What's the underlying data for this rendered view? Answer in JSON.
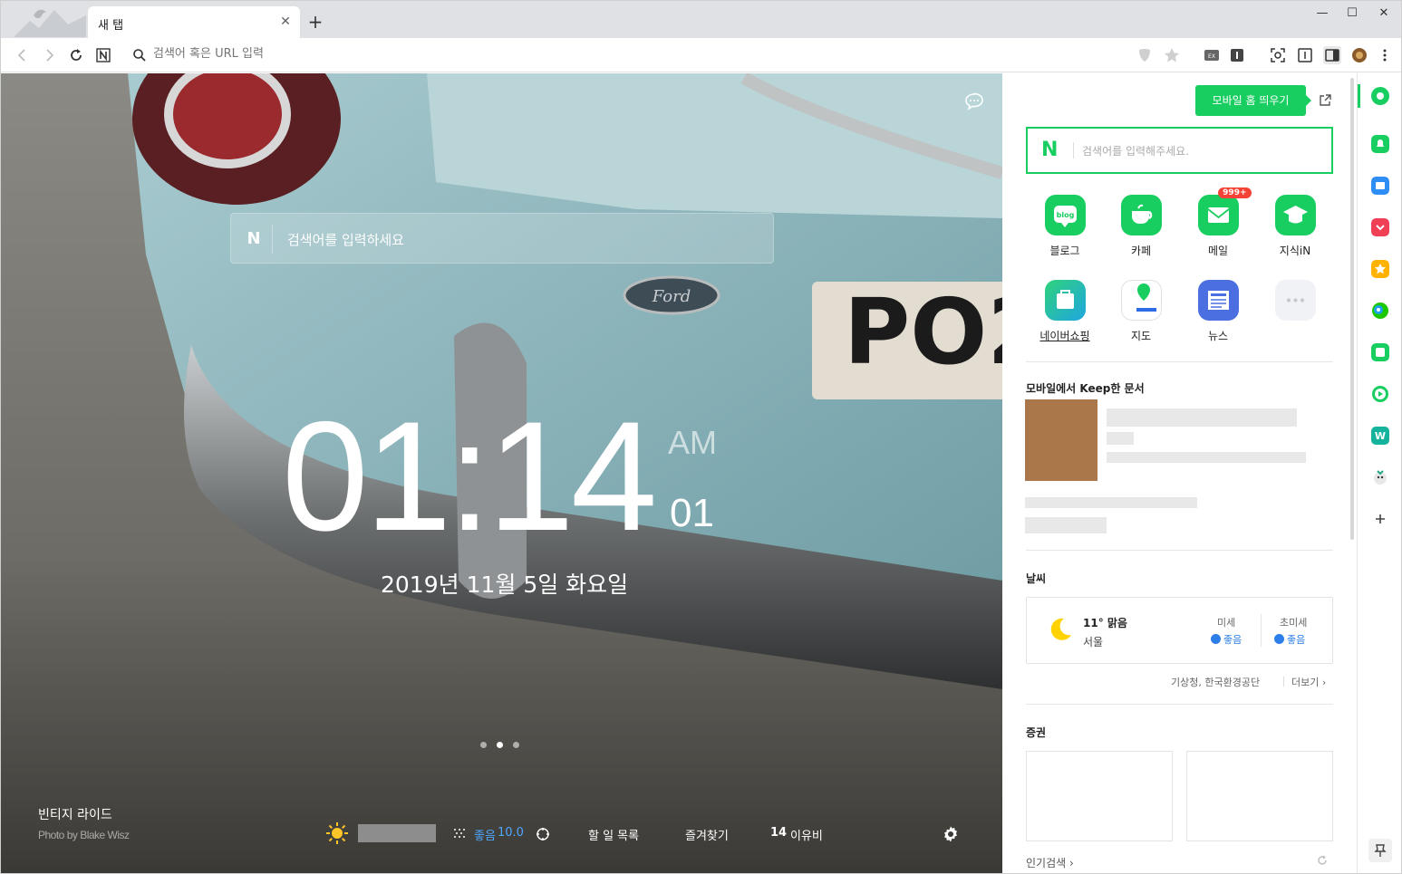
{
  "browser": {
    "tab_title": "새 탭",
    "close_glyph": "✕",
    "new_tab_glyph": "+",
    "window_controls": {
      "minimize": "—",
      "maximize": "☐",
      "close": "✕"
    },
    "address_placeholder": "검색어 혹은 URL 입력",
    "icons": [
      "back-icon",
      "forward-icon",
      "reload-icon",
      "naver-home-icon",
      "search-icon",
      "shield-icon",
      "star-icon",
      "extension-icon",
      "info-icon",
      "capture-icon",
      "reader-icon",
      "sidebar-icon",
      "profile-avatar",
      "menu-icon"
    ]
  },
  "hero": {
    "search_placeholder": "검색어를 입력하세요",
    "naver_glyph": "N",
    "time": "01:14",
    "ampm": "AM",
    "seconds": "01",
    "date": "2019년 11월 5일 화요일",
    "slides": 3,
    "active_slide": 2,
    "photo_title": "빈티지 라이드",
    "photo_credit": "Photo by Blake Wisz",
    "bottom": {
      "air_label": "좋음",
      "air_value": "10.0",
      "todo": "할 일 목록",
      "favorites": "즐겨찾기",
      "days_count": "14",
      "days_label": "이유비"
    }
  },
  "panel": {
    "mobile_home_button": "모바일 홈 띄우기",
    "search_placeholder": "검색어를 입력해주세요.",
    "naver_glyph": "N",
    "apps": [
      {
        "label": "블로그",
        "icon": "blog-icon"
      },
      {
        "label": "카페",
        "icon": "cafe-icon"
      },
      {
        "label": "메일",
        "icon": "mail-icon",
        "badge": "999+"
      },
      {
        "label": "지식iN",
        "icon": "kin-icon"
      },
      {
        "label": "네이버쇼핑",
        "icon": "shopping-icon"
      },
      {
        "label": "지도",
        "icon": "map-icon"
      },
      {
        "label": "뉴스",
        "icon": "news-icon"
      },
      {
        "label": "",
        "icon": "more-icon"
      }
    ],
    "keep_title": "모바일에서 Keep한 문서",
    "weather_title": "날씨",
    "weather": {
      "temp_state": "11° 맑음",
      "city": "서울",
      "fine_dust_label": "미세",
      "fine_dust_value": "좋음",
      "ultra_fine_label": "초미세",
      "ultra_fine_value": "좋음",
      "source": "기상청, 한국환경공단",
      "more": "더보기 ›"
    },
    "stock_title": "증권",
    "popular": "인기검색 ›"
  },
  "colors": {
    "naver_green": "#19ce60",
    "badge_red": "#f44336"
  }
}
